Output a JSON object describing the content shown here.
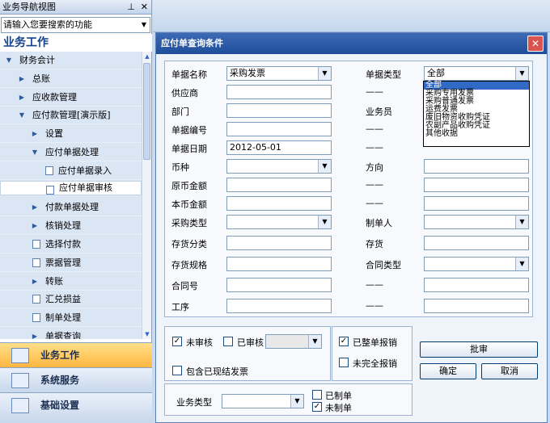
{
  "left_panel": {
    "title": "业务导航视图",
    "pin_icon": "pin-icon",
    "close_icon": "close-icon",
    "search_placeholder": "请输入您要搜索的功能",
    "header": "业务工作",
    "tree": [
      {
        "label": "财务会计",
        "level": 0,
        "type": "expanded"
      },
      {
        "label": "总账",
        "level": 1,
        "type": "collapsed"
      },
      {
        "label": "应收款管理",
        "level": 1,
        "type": "collapsed"
      },
      {
        "label": "应付款管理[演示版]",
        "level": 1,
        "type": "expanded"
      },
      {
        "label": "设置",
        "level": 2,
        "type": "collapsed"
      },
      {
        "label": "应付单据处理",
        "level": 2,
        "type": "expanded"
      },
      {
        "label": "应付单据录入",
        "level": 3,
        "type": "doc"
      },
      {
        "label": "应付单据审核",
        "level": 3,
        "type": "doc",
        "selected": true
      },
      {
        "label": "付款单据处理",
        "level": 2,
        "type": "collapsed"
      },
      {
        "label": "核销处理",
        "level": 2,
        "type": "collapsed"
      },
      {
        "label": "选择付款",
        "level": 2,
        "type": "doc"
      },
      {
        "label": "票据管理",
        "level": 2,
        "type": "doc"
      },
      {
        "label": "转账",
        "level": 2,
        "type": "collapsed"
      },
      {
        "label": "汇兑损益",
        "level": 2,
        "type": "doc"
      },
      {
        "label": "制单处理",
        "level": 2,
        "type": "doc"
      },
      {
        "label": "单据查询",
        "level": 2,
        "type": "collapsed"
      }
    ],
    "nav_buttons": [
      {
        "label": "业务工作",
        "active": true
      },
      {
        "label": "系统服务",
        "active": false
      },
      {
        "label": "基础设置",
        "active": false
      }
    ]
  },
  "dialog": {
    "title": "应付单查询条件",
    "fields": {
      "doc_name_label": "单据名称",
      "doc_name_value": "采购发票",
      "supplier_label": "供应商",
      "dept_label": "部门",
      "doc_no_label": "单据编号",
      "doc_date_label": "单据日期",
      "doc_date_value": "2012-05-01",
      "currency_label": "币种",
      "orig_amount_label": "原币金额",
      "local_amount_label": "本币金额",
      "purchase_type_label": "采购类型",
      "stock_class_label": "存货分类",
      "stock_spec_label": "存货规格",
      "contract_no_label": "合同号",
      "process_label": "工序",
      "doc_type_label": "单据类型",
      "doc_type_value": "全部",
      "salesman_label": "业务员",
      "direction_label": "方向",
      "maker_label": "制单人",
      "stock_label": "存货",
      "contract_type_label": "合同类型",
      "dash": "——"
    },
    "doc_type_options": [
      "全部",
      "采购专用发票",
      "采购普通发票",
      "运费发票",
      "废旧物资收购凭证",
      "农副产品收购凭证",
      "其他收据"
    ],
    "filters": {
      "unaudited": "未审核",
      "audited": "已审核",
      "full_reimbursed": "已整单报销",
      "partial_reimbursed": "未完全报销",
      "include_settled": "包含已现结发票",
      "business_type": "业务类型",
      "made": "已制单",
      "unmade": "未制单"
    },
    "buttons": {
      "batch_audit": "批审",
      "ok": "确定",
      "cancel": "取消"
    }
  }
}
